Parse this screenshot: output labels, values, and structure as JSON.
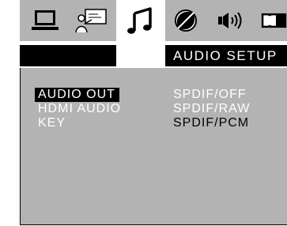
{
  "tabs": [
    {
      "name": "general-setup",
      "icon": "monitor-icon"
    },
    {
      "name": "speaker-setup",
      "icon": "presenter-icon"
    },
    {
      "name": "audio-setup",
      "icon": "music-note-icon",
      "active": true
    },
    {
      "name": "video-setup",
      "icon": "contrast-icon"
    },
    {
      "name": "speaker-output",
      "icon": "speaker-icon"
    },
    {
      "name": "dolby",
      "icon": "dolby-icon"
    }
  ],
  "header": {
    "title": "AUDIO  SETUP"
  },
  "menu": {
    "items": [
      {
        "label": "AUDIO  OUT",
        "selected": true
      },
      {
        "label": "HDMI  AUDIO"
      },
      {
        "label": "KEY"
      }
    ],
    "options": [
      {
        "label": "SPDIF/OFF"
      },
      {
        "label": "SPDIF/RAW"
      },
      {
        "label": "SPDIF/PCM",
        "current": true
      }
    ]
  },
  "colors": {
    "background": "#b3b3b3",
    "highlight": "#000000",
    "text": "#ffffff"
  }
}
